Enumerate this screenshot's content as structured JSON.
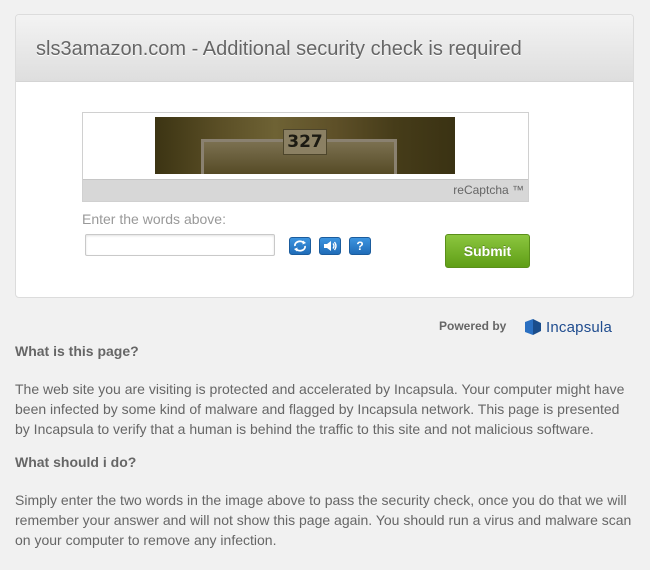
{
  "header": {
    "title": "sls3amazon.com - Additional security check is required"
  },
  "captcha": {
    "image_text": "327",
    "footer_label": "reCaptcha ™",
    "enter_label": "Enter the words above:",
    "answer_value": "",
    "tools": [
      {
        "name": "refresh",
        "icon": "refresh-icon"
      },
      {
        "name": "audio",
        "icon": "speaker-icon"
      },
      {
        "name": "help",
        "icon": "help-icon",
        "glyph": "?"
      }
    ],
    "submit_label": "Submit"
  },
  "footer_brand": {
    "powered_by": "Powered by",
    "brand_name": "Incapsula",
    "brand_color": "#1f4c8f"
  },
  "info": {
    "q1": "What is this page?",
    "a1": "The web site you are visiting is protected and accelerated by Incapsula. Your computer might have been infected by some kind of malware and flagged by Incapsula network. This page is presented by Incapsula to verify that a human is behind the traffic to this site and not malicious software.",
    "q2": "What should i do?",
    "a2": "Simply enter the two words in the image above to pass the security check, once you do that we will remember your answer and will not show this page again. You should run a virus and malware scan on your computer to remove any infection."
  },
  "colors": {
    "submit_green": "#6fb02a",
    "tool_blue": "#2b7fcc",
    "background": "#f1f1f1"
  }
}
